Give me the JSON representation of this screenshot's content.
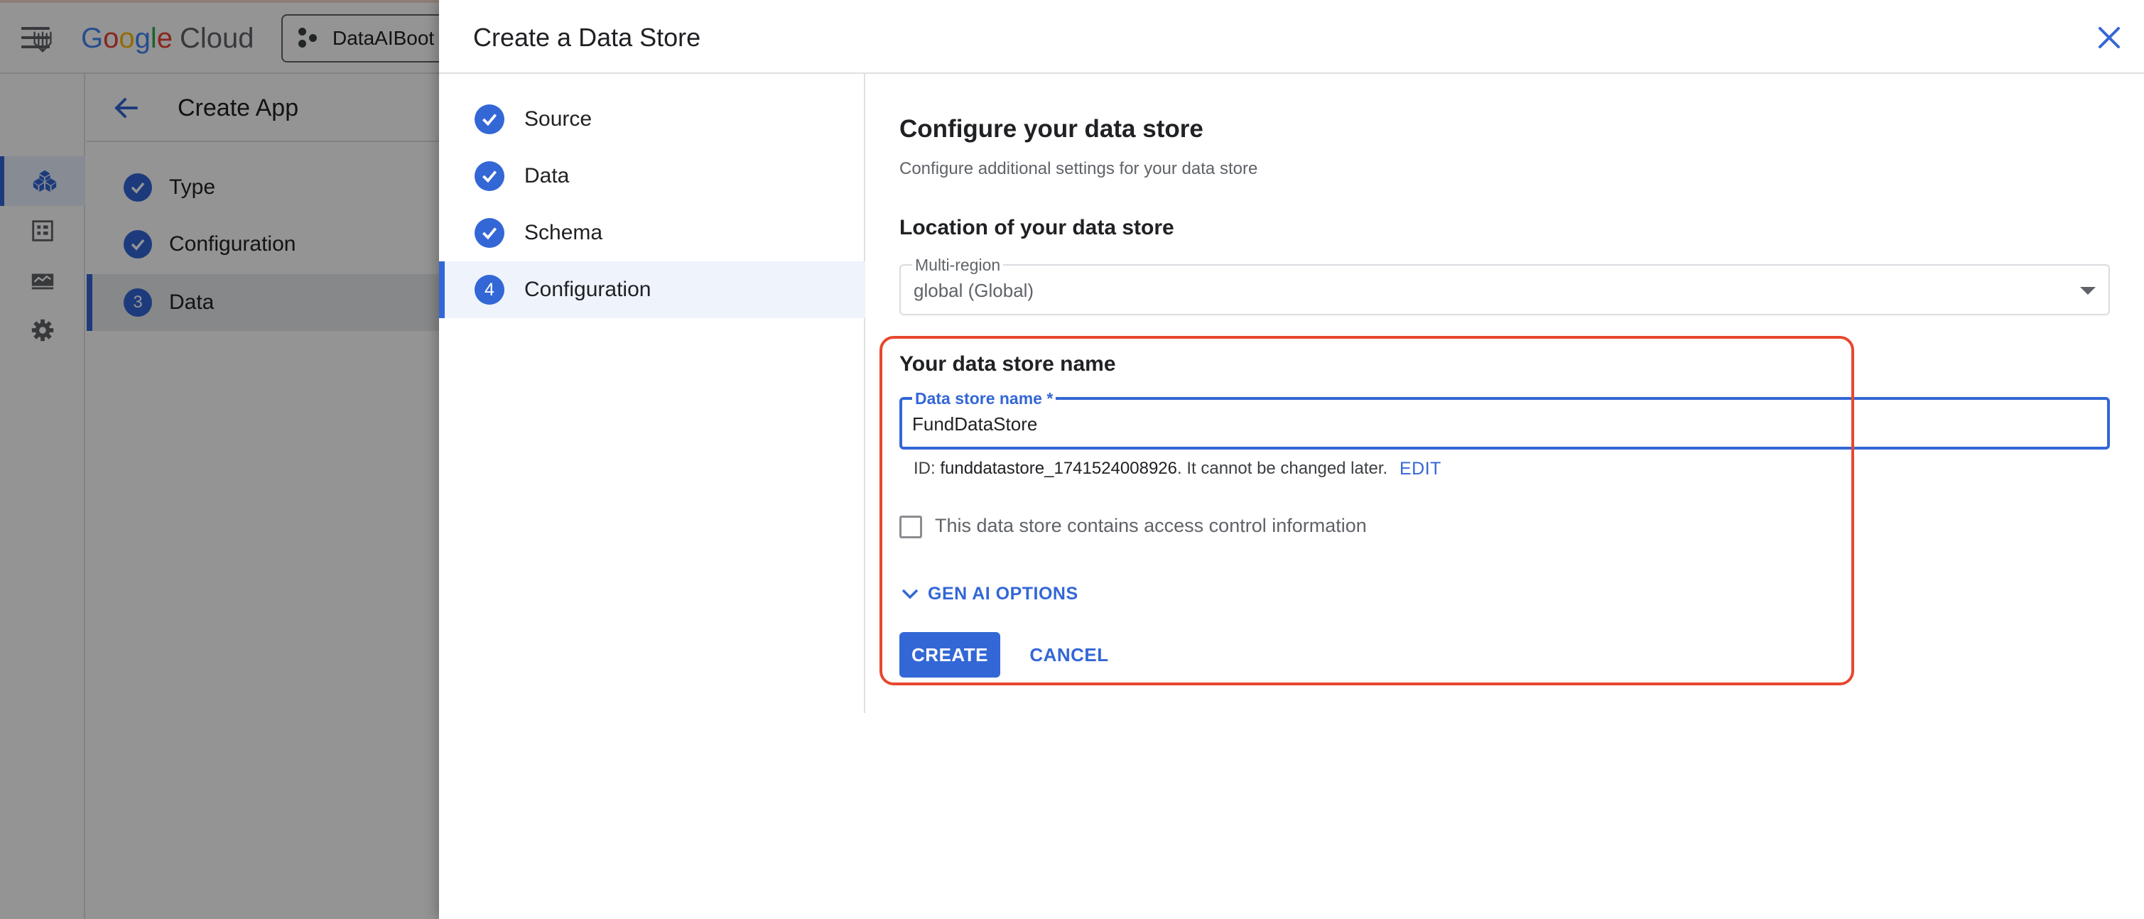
{
  "console": {
    "brand_letters": [
      "G",
      "o",
      "o",
      "g",
      "l",
      "e"
    ],
    "brand_product": "Cloud",
    "project_name": "DataAIBoot",
    "page_title": "Create App",
    "steps": [
      {
        "label": "Type",
        "status": "done"
      },
      {
        "label": "Configuration",
        "status": "done"
      },
      {
        "label": "Data",
        "status": "current",
        "number": "3"
      }
    ]
  },
  "dialog": {
    "title": "Create a Data Store",
    "steps": [
      {
        "label": "Source",
        "status": "done"
      },
      {
        "label": "Data",
        "status": "done"
      },
      {
        "label": "Schema",
        "status": "done"
      },
      {
        "label": "Configuration",
        "status": "current",
        "number": "4"
      }
    ]
  },
  "config": {
    "title": "Configure your data store",
    "subtitle": "Configure additional settings for your data store",
    "location_title": "Location of your data store",
    "region_label": "Multi-region",
    "region_value": "global (Global)",
    "name_title": "Your data store name",
    "name_label": "Data store name *",
    "name_value": "FundDataStore",
    "id_prefix": "ID: ",
    "id_value": "funddatastore_1741524008926",
    "id_suffix": ". It cannot be changed later.",
    "edit_label": "EDIT",
    "acl_label": "This data store contains access control information",
    "acl_checked": false,
    "genai_label": "GEN AI OPTIONS",
    "create_label": "CREATE",
    "cancel_label": "CANCEL"
  },
  "colors": {
    "accent": "#3367d6",
    "highlight": "#e8472f"
  }
}
